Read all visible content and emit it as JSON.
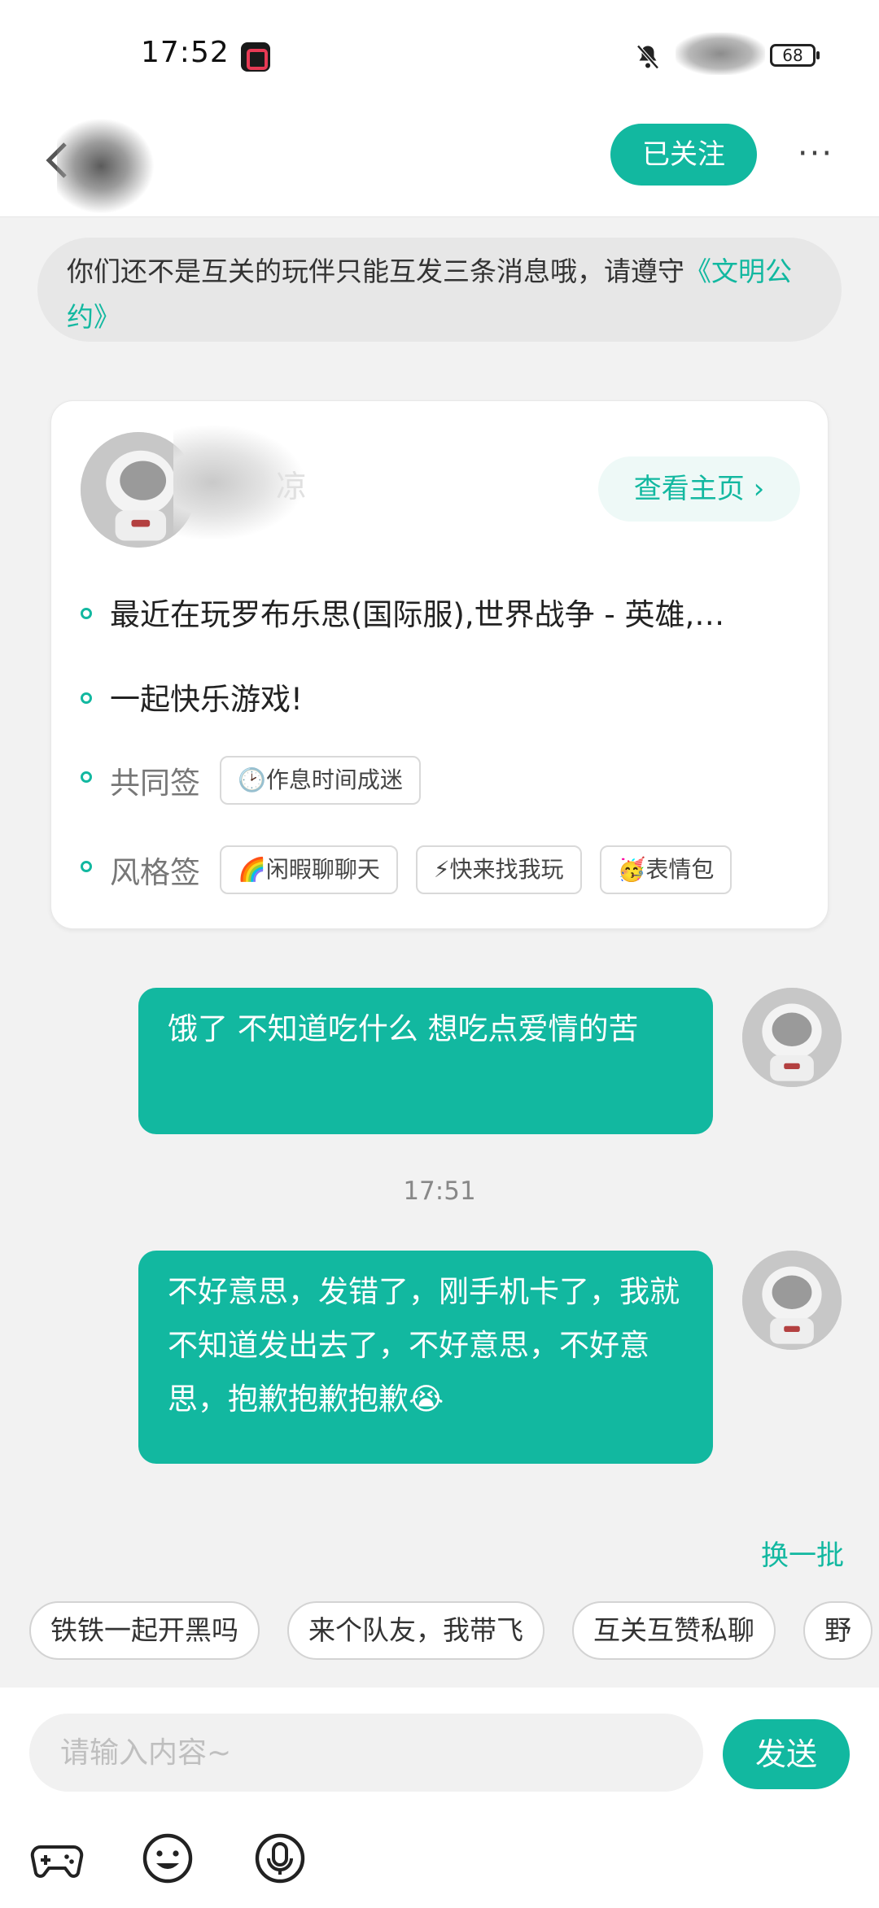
{
  "status_bar": {
    "time": "17:52",
    "battery": "68"
  },
  "header": {
    "follow_label": "已关注",
    "more_label": "···"
  },
  "notice": {
    "text": "你们还不是互关的玩伴只能互发三条消息哦，请遵守",
    "link": "《文明公约》"
  },
  "profile_card": {
    "name_partial": "凉",
    "view_home_label": "查看主页 ›",
    "recent_games": "最近在玩罗布乐思(国际服),世界战争 - 英雄,…",
    "bio": "一起快乐游戏!",
    "common_tags_label": "共同签",
    "common_tags": [
      "🕑作息时间成迷"
    ],
    "style_tags_label": "风格签",
    "style_tags": [
      "🌈闲暇聊聊天",
      "⚡快来找我玩",
      "🥳表情包"
    ]
  },
  "messages": [
    {
      "text": "饿了 不知道吃什么 想吃点爱情的苦"
    },
    {
      "text": "不好意思，发错了，刚手机卡了，我就不知道发出去了，不好意思，不好意思，抱歉抱歉抱歉😭"
    }
  ],
  "timestamp": "17:51",
  "quick_replies": {
    "refresh_label": "换一批",
    "items": [
      "铁铁一起开黑吗",
      "来个队友，我带飞",
      "互关互赞私聊",
      "野"
    ]
  },
  "input": {
    "placeholder": "请输入内容~",
    "send_label": "发送"
  },
  "toolbar_icons": [
    "gamepad-icon",
    "emoji-icon",
    "microphone-icon"
  ],
  "colors": {
    "accent": "#12b8a0",
    "background": "#f2f2f2"
  }
}
